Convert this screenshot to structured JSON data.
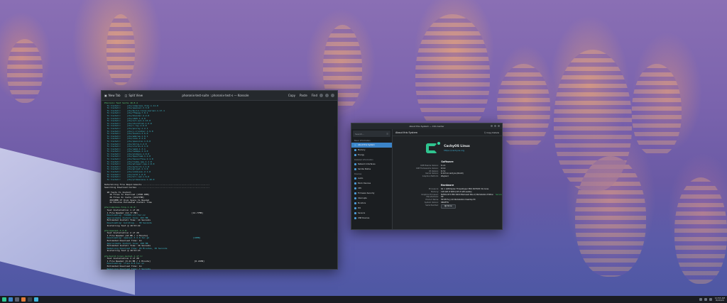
{
  "terminal": {
    "tab_new": "New Tab",
    "tab_split": "Split View",
    "title": "phoronix-test-suite : phoronix-test-s — Konsole",
    "copy": "Copy",
    "paste": "Paste",
    "find": "Find",
    "lines": [
      {
        "t": "Phoronix Test Suite 10.8.4",
        "c": "c2"
      },
      {
        "t": "  To Install:     pts/compress-7zip-1.11.0",
        "c": "c1"
      },
      {
        "t": "  To Install:     pts/openssl-3.3.0",
        "c": "c1"
      },
      {
        "t": "  To Install:     pts/build-linux-kernel-1.17.1",
        "c": "c1"
      },
      {
        "t": "  To Install:     pts/ffmpeg-7.0.1",
        "c": "c1"
      },
      {
        "t": "  To Install:     pts/blender-4.2.0",
        "c": "c1"
      },
      {
        "t": "  To Install:     pts/x265-1.4.0",
        "c": "c1"
      },
      {
        "t": "  To Install:     pts/svt-av1-2.15.0",
        "c": "c1"
      },
      {
        "t": "  To Install:     pts/stockfish-1.6.0",
        "c": "c1"
      },
      {
        "t": "  To Install:     pts/c-ray-2.0.0",
        "c": "c1"
      },
      {
        "t": "  To Install:     pts/povray-1.2.1",
        "c": "c1"
      },
      {
        "t": "  To Install:     pts/y-cruncher-1.5.0",
        "c": "c1"
      },
      {
        "t": "  To Install:     pts/onednn-3.6.0",
        "c": "c1"
      },
      {
        "t": "  To Install:     pts/embree-1.6.1",
        "c": "c1"
      },
      {
        "t": "  To Install:     pts/oidn-2.3.0",
        "c": "c1"
      },
      {
        "t": "  To Install:     pts/openvino-1.6.0",
        "c": "c1"
      },
      {
        "t": "  To Install:     pts/xmrig-1.2.0",
        "c": "c1"
      },
      {
        "t": "  To Install:     pts/srsran-2.1.0",
        "c": "c1"
      },
      {
        "t": "  To Install:     pts/namd-1.3.1",
        "c": "c1"
      },
      {
        "t": "  To Install:     pts/lammps-1.4.0",
        "c": "c1"
      },
      {
        "t": "  To Install:     pts/gromacs-1.9.0",
        "c": "c1"
      },
      {
        "t": "  To Install:     pts/openfoam-1.2.0",
        "c": "c1"
      },
      {
        "t": "  To Install:     pts/tensorflow-2.1.0",
        "c": "c1"
      },
      {
        "t": "  To Install:     pts/llama-cpp-1.1.0",
        "c": "c1"
      },
      {
        "t": "  To Install:     pts/whisper-cpp-1.0.0",
        "c": "c1"
      },
      {
        "t": "  To Install:     pts/pytorch-1.1.0",
        "c": "c1"
      },
      {
        "t": "  To Install:     pts/gcrypt-1.3.0",
        "c": "c1"
      },
      {
        "t": "  To Install:     pts/simdjson-2.1.0",
        "c": "c1"
      },
      {
        "t": "  To Install:     pts/zstd-1.6.0",
        "c": "c1"
      },
      {
        "t": "  To Install:     pts/brl-cad-1.6.0",
        "c": "c1"
      },
      {
        "t": "  To Install:     pts/primesieve-1.10.0",
        "c": "c1"
      },
      {
        "t": "",
        "c": "c3"
      },
      {
        "t": "Determining File Requirements ....................................................",
        "c": "c3"
      },
      {
        "t": "Searching Download Caches ........................................................",
        "c": "c3"
      },
      {
        "t": "",
        "c": "c3"
      },
      {
        "t": "  28 Tests To Install",
        "c": "c3"
      },
      {
        "t": "    16 Files To Download [4390.6MB]",
        "c": "c3"
      },
      {
        "t": "    30 Files In Cache [16477MB]",
        "c": "c3"
      },
      {
        "t": "    20158MB Of Disk Space Is Needed",
        "c": "c3"
      },
      {
        "t": "    32 Minutes Estimated Install Time",
        "c": "c3"
      },
      {
        "t": "",
        "c": "c3"
      },
      {
        "t": "pts/compress-7zip-1.11.0:",
        "c": "c2"
      },
      {
        "t": "  Test Installation 1 of 28",
        "c": "c3"
      },
      {
        "t": "  1 File Needed [14.77 MB]                                          [14.77MB]",
        "c": "c3"
      },
      {
        "t": "  Downloading: 7z2409-src.tar.xz",
        "c": "c1"
      },
      {
        "t": "  Approximate Install Size: 263 MB",
        "c": "c1"
      },
      {
        "t": "  Estimated Install Time: 14 Seconds",
        "c": "c3"
      },
      {
        "t": "  Downloading: building... 38 Seconds",
        "c": "c1"
      },
      {
        "t": "  Installing Test @ 10:53:22",
        "c": "c3"
      },
      {
        "t": "",
        "c": "c3"
      },
      {
        "t": "pts/openssl-3.3.0:",
        "c": "c2"
      },
      {
        "t": "  Test Installation 2 of 28",
        "c": "c3"
      },
      {
        "t": "  1 File Needed [18 MB / 1 Minute]",
        "c": "c3"
      },
      {
        "t": "  Downloading: openssl-3.3.0.tar.gz                                  [18MB]",
        "c": "c1"
      },
      {
        "t": "  Estimated Download Time: 1m",
        "c": "c3"
      },
      {
        "t": "  Approximate Install Size: 258 MB",
        "c": "c1"
      },
      {
        "t": "  Estimated Install Time: 36 Seconds",
        "c": "c3"
      },
      {
        "t": "  Remaining Download Time: 28 Minutes, 38 Seconds",
        "c": "c1"
      },
      {
        "t": "  Installing Test @ 10:53:23",
        "c": "c3"
      },
      {
        "t": "",
        "c": "c3"
      },
      {
        "t": "pts/build-linux-kernel-1.17.1:",
        "c": "c2"
      },
      {
        "t": "  Test Installation 3 of 28",
        "c": "c3"
      },
      {
        "t": "  1 File Needed [0.21 MB / 1 Minute]                                  [0.21MB]",
        "c": "c3"
      },
      {
        "t": "  Downloading: linux-6.8.tar.xz",
        "c": "c1"
      },
      {
        "t": "  Estimated Download Time: 1m",
        "c": "c3"
      },
      {
        "t": "  Remaining Download Time: 7 Seconds",
        "c": "c1"
      },
      {
        "t": "  Approximate Install Size: 2.0 GB, 30 Seconds",
        "c": "c1"
      },
      {
        "t": "  Installing Test @ 10:53:31",
        "c": "c3"
      }
    ]
  },
  "sysinfo": {
    "title": "About this System — Info Center",
    "search_placeholder": "Search...",
    "sidebar_group_basic": "Basic Information",
    "sidebar_group_details": "Detailed Information",
    "sidebar_group_devices": "Devices",
    "sidebar": [
      "About this System",
      "Memory",
      "Energy",
      "Network Interfaces",
      "Samba Status",
      "Audio",
      "Block Devices",
      "CPU",
      "Firmware Security",
      "Interrupts",
      "Monitors",
      "PCI",
      "Sensors",
      "USB Devices"
    ],
    "header_title": "About this System",
    "copy_details": "Copy Details",
    "brand_name": "CachyOS Linux",
    "brand_url": "https://cachyos.org",
    "software_heading": "Software",
    "software": [
      {
        "k": "KDE Plasma Version:",
        "v": "6.1.4"
      },
      {
        "k": "KDE Frameworks Version:",
        "v": "6.5.0"
      },
      {
        "k": "Qt Version:",
        "v": "6.7.2"
      },
      {
        "k": "Kernel Version:",
        "v": "6.10.5-2-cachyos (64-bit)"
      },
      {
        "k": "Graphics Platform:",
        "v": "Wayland"
      }
    ],
    "hardware_heading": "Hardware",
    "hardware": [
      {
        "k": "Processors:",
        "v": "64 × AMD Ryzen Threadripper PRO 9975WX 32-Cores"
      },
      {
        "k": "Memory:",
        "v": "128 GiB of RAM (125.5 GiB usable)"
      },
      {
        "k": "Graphics Processor:",
        "v": "NVIDIA RTX PRO 6000 Blackwell Max-Q Workstation Edition",
        "ok": "Secure"
      },
      {
        "k": "Manufacturer:",
        "v": "HP"
      },
      {
        "k": "Product Name:",
        "v": "HP Z8 Fury G5 Workstation Desktop PC"
      },
      {
        "k": "System Version:",
        "v": "SBKPF0V"
      }
    ],
    "serial_label": "Serial Number:",
    "show_label": "Show"
  },
  "taskbar": {
    "time": "10:53 AM",
    "date": "8/20/24"
  }
}
